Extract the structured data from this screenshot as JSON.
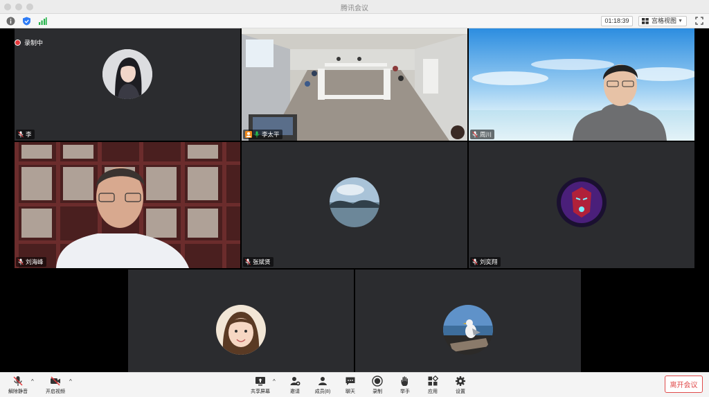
{
  "window": {
    "title": "腾讯会议"
  },
  "toolbar": {
    "timer": "01:18:39",
    "view_label": "宫格视图"
  },
  "recording": {
    "label": "录制中"
  },
  "participants": [
    {
      "name": "李"
    },
    {
      "name": "李太平"
    },
    {
      "name": "周川"
    },
    {
      "name": "刘海峰"
    },
    {
      "name": "张斌贤"
    },
    {
      "name": "刘奕翔"
    },
    {
      "name": ""
    },
    {
      "name": ""
    }
  ],
  "bottombar": {
    "unmute": "解除静音",
    "start_video": "开启视频",
    "share_screen": "共享屏幕",
    "invite": "邀请",
    "members": "成员(8)",
    "chat": "聊天",
    "record": "录制",
    "raise_hand": "举手",
    "apps": "应用",
    "settings": "设置",
    "leave": "离开会议"
  },
  "colors": {
    "accent_green": "#1fbf4c",
    "leave_red": "#e04a4a",
    "record_red": "#e4393c"
  }
}
